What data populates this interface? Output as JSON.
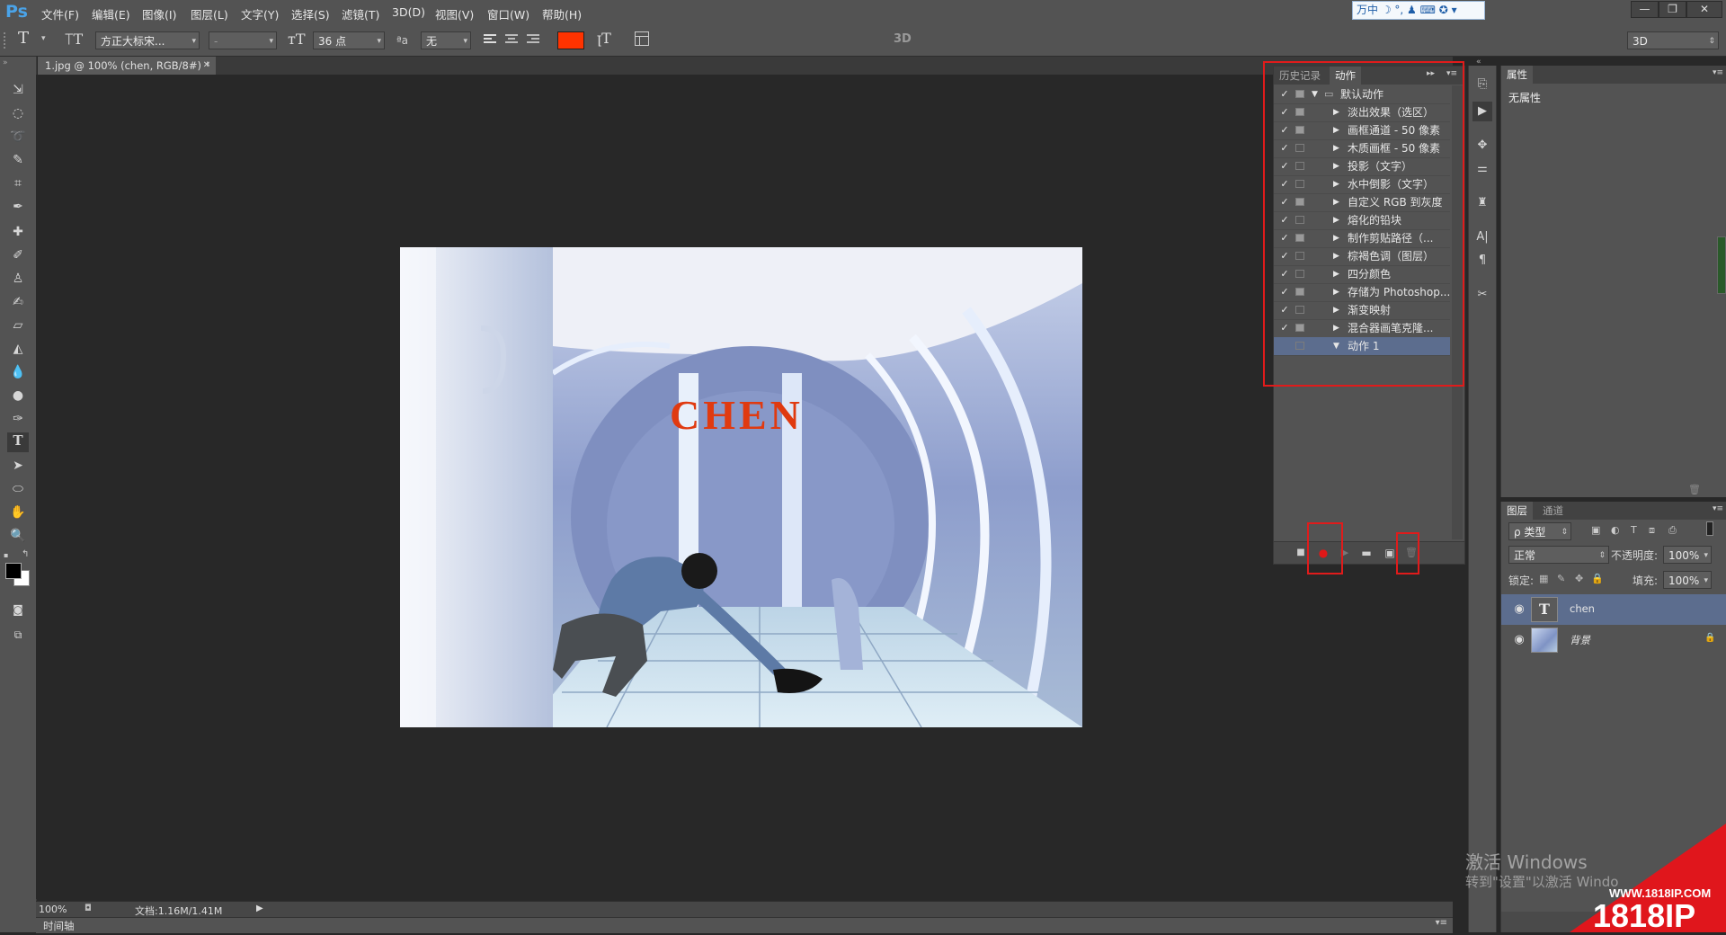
{
  "menubar": {
    "logo": "Ps",
    "items": [
      "文件(F)",
      "编辑(E)",
      "图像(I)",
      "图层(L)",
      "文字(Y)",
      "选择(S)",
      "滤镜(T)",
      "3D(D)",
      "视图(V)",
      "窗口(W)",
      "帮助(H)"
    ],
    "ime": "万中 ☽ °, ♟ ⌨ ✪ ▾",
    "window_buttons": [
      "—",
      "❐",
      "✕"
    ]
  },
  "options": {
    "font_family": "方正大标宋...",
    "font_style": "-",
    "font_size": "36 点",
    "aa_label": "ªa",
    "antialias": "无",
    "text_color": "#ff3300",
    "mode_3d_label": "3D",
    "workspace": "3D"
  },
  "document": {
    "tab_title": "1.jpg @ 100% (chen, RGB/8#) *",
    "overlay_text": "CHEN"
  },
  "actions_panel": {
    "tabs": [
      "历史记录",
      "动作"
    ],
    "active_tab": "动作",
    "set_name": "默认动作",
    "items": [
      {
        "label": "淡出效果（选区）",
        "checked": true,
        "dialog": true
      },
      {
        "label": "画框通道 - 50 像素",
        "checked": true,
        "dialog": true
      },
      {
        "label": "木质画框 - 50 像素",
        "checked": true,
        "dialog": false
      },
      {
        "label": "投影（文字）",
        "checked": true,
        "dialog": false
      },
      {
        "label": "水中倒影（文字）",
        "checked": true,
        "dialog": false
      },
      {
        "label": "自定义 RGB 到灰度",
        "checked": true,
        "dialog": true
      },
      {
        "label": "熔化的铅块",
        "checked": true,
        "dialog": false
      },
      {
        "label": "制作剪贴路径（...",
        "checked": true,
        "dialog": true
      },
      {
        "label": "棕褐色调（图层）",
        "checked": true,
        "dialog": false
      },
      {
        "label": "四分颜色",
        "checked": true,
        "dialog": false
      },
      {
        "label": "存储为 Photoshop...",
        "checked": true,
        "dialog": true
      },
      {
        "label": "渐变映射",
        "checked": true,
        "dialog": false
      },
      {
        "label": "混合器画笔克隆...",
        "checked": true,
        "dialog": true
      }
    ],
    "new_action": "动作 1"
  },
  "properties": {
    "tab": "属性",
    "value": "无属性"
  },
  "layers": {
    "tabs": [
      "图层",
      "通道"
    ],
    "filter": "ρ 类型",
    "blend_mode": "正常",
    "opacity_label": "不透明度:",
    "opacity": "100%",
    "lock_label": "锁定:",
    "fill_label": "填充:",
    "fill": "100%",
    "items": [
      {
        "name": "chen",
        "thumb": "T"
      },
      {
        "name": "背景",
        "thumb": ""
      }
    ]
  },
  "status": {
    "zoom": "100%",
    "doc_info": "文档:1.16M/1.41M"
  },
  "timeline": {
    "label": "时间轴"
  },
  "watermark": {
    "line1": "激活 Windows",
    "line2": "转到\"设置\"以激活 Windo"
  },
  "site": {
    "url": "WWW.1818IP.COM",
    "brand": "1818IP"
  }
}
